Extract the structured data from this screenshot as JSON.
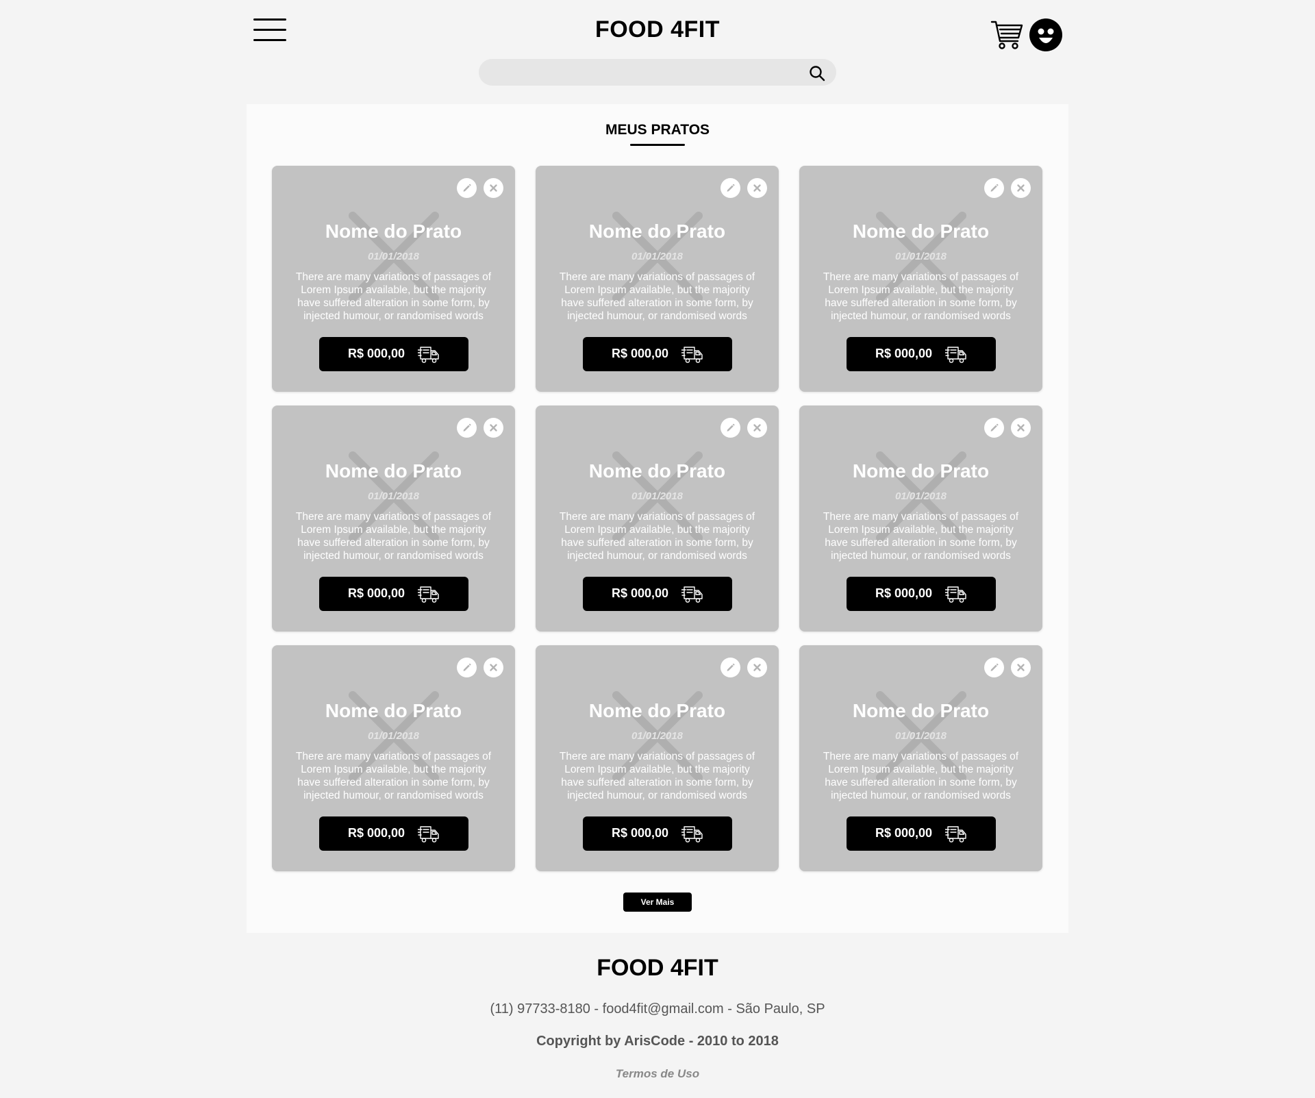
{
  "header": {
    "logo": "FOOD 4FIT",
    "menu_icon": "hamburger-menu-icon",
    "cart_icon": "shopping-cart-icon",
    "avatar_icon": "smiley-face-icon",
    "search": {
      "value": "",
      "placeholder": "",
      "icon": "search-icon"
    }
  },
  "main": {
    "section_title": "MEUS PRATOS",
    "cards": [
      {
        "title": "Nome do Prato",
        "date": "01/01/2018",
        "description": "There are many variations of passages of Lorem Ipsum available, but the majority have suffered alteration in some form, by injected humour, or randomised words",
        "price": "R$ 000,00"
      },
      {
        "title": "Nome do Prato",
        "date": "01/01/2018",
        "description": "There are many variations of passages of Lorem Ipsum available, but the majority have suffered alteration in some form, by injected humour, or randomised words",
        "price": "R$ 000,00"
      },
      {
        "title": "Nome do Prato",
        "date": "01/01/2018",
        "description": "There are many variations of passages of Lorem Ipsum available, but the majority have suffered alteration in some form, by injected humour, or randomised words",
        "price": "R$ 000,00"
      },
      {
        "title": "Nome do Prato",
        "date": "01/01/2018",
        "description": "There are many variations of passages of Lorem Ipsum available, but the majority have suffered alteration in some form, by injected humour, or randomised words",
        "price": "R$ 000,00"
      },
      {
        "title": "Nome do Prato",
        "date": "01/01/2018",
        "description": "There are many variations of passages of Lorem Ipsum available, but the majority have suffered alteration in some form, by injected humour, or randomised words",
        "price": "R$ 000,00"
      },
      {
        "title": "Nome do Prato",
        "date": "01/01/2018",
        "description": "There are many variations of passages of Lorem Ipsum available, but the majority have suffered alteration in some form, by injected humour, or randomised words",
        "price": "R$ 000,00"
      },
      {
        "title": "Nome do Prato",
        "date": "01/01/2018",
        "description": "There are many variations of passages of Lorem Ipsum available, but the majority have suffered alteration in some form, by injected humour, or randomised words",
        "price": "R$ 000,00"
      },
      {
        "title": "Nome do Prato",
        "date": "01/01/2018",
        "description": "There are many variations of passages of Lorem Ipsum available, but the majority have suffered alteration in some form, by injected humour, or randomised words",
        "price": "R$ 000,00"
      },
      {
        "title": "Nome do Prato",
        "date": "01/01/2018",
        "description": "There are many variations of passages of Lorem Ipsum available, but the majority have suffered alteration in some form, by injected humour, or randomised words",
        "price": "R$ 000,00"
      }
    ],
    "card_icons": {
      "edit": "pencil-edit-icon",
      "delete": "close-x-icon",
      "delivery": "delivery-truck-icon",
      "placeholder": "image-placeholder-icon"
    },
    "ver_mais_label": "Ver Mais"
  },
  "footer": {
    "logo": "FOOD 4FIT",
    "contact": "(11) 97733-8180 - food4fit@gmail.com - São Paulo, SP",
    "copyright": "Copyright by ArisCode - 2010 to 2018",
    "terms": "Termos de Uso"
  },
  "colors": {
    "page_background": "#f4f4f4",
    "content_background": "#fbfbfb",
    "card_background": "#c2c2c2",
    "button_background": "#000000",
    "text_primary": "#000000",
    "footer_text": "#555555",
    "footer_link": "#888888"
  }
}
